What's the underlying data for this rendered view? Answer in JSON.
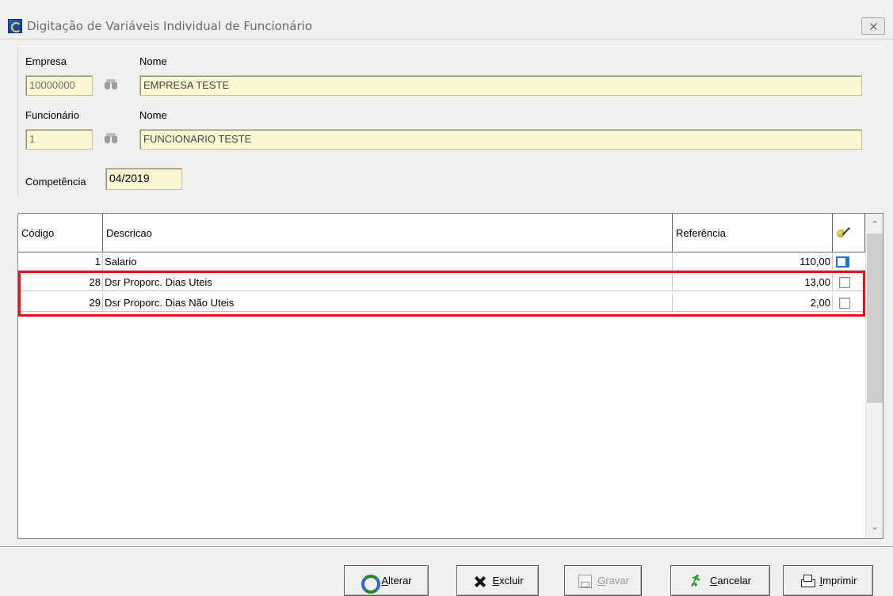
{
  "window": {
    "title": "Digitação de Variáveis Individual de Funcionário"
  },
  "empresa": {
    "label": "Empresa",
    "code": "10000000",
    "name_label": "Nome",
    "name": "EMPRESA TESTE"
  },
  "funcionario": {
    "label": "Funcionário",
    "code": "1",
    "name_label": "Nome",
    "name": "FUNCIONARIO TESTE"
  },
  "competencia": {
    "label": "Competência",
    "value": "04/2019"
  },
  "grid": {
    "headers": {
      "codigo": "Código",
      "descricao": "Descricao",
      "referencia": "Referência"
    },
    "rows": [
      {
        "codigo": "1",
        "descricao": "Salario",
        "referencia": "110,00",
        "checked": false
      },
      {
        "codigo": "28",
        "descricao": "Dsr Proporc. Dias Uteis",
        "referencia": "13,00",
        "checked": false
      },
      {
        "codigo": "29",
        "descricao": "Dsr Proporc. Dias Não Uteis",
        "referencia": "2,00",
        "checked": false
      }
    ]
  },
  "buttons": {
    "alterar": {
      "first": "A",
      "rest": "lterar"
    },
    "excluir": {
      "first": "E",
      "rest": "xcluir"
    },
    "gravar": {
      "first": "G",
      "rest": "ravar"
    },
    "cancelar": {
      "first": "C",
      "rest": "ancelar"
    },
    "imprimir": {
      "first": "I",
      "rest": "mprimir"
    }
  },
  "colors": {
    "field_bg": "#fbf7d2",
    "highlight": "#e8111a",
    "selection": "#1f73d6"
  },
  "icons": [
    "app-icon",
    "close-icon",
    "binoculars-icon",
    "wand-icon",
    "refresh-icon",
    "x-icon",
    "disk-icon",
    "runner-icon",
    "printer-icon"
  ]
}
